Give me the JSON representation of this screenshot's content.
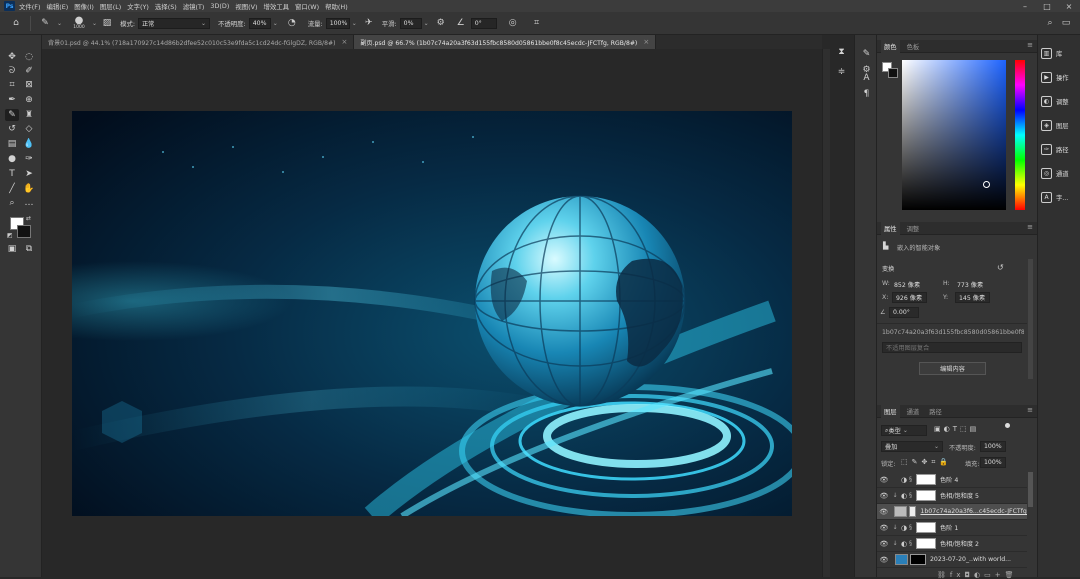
{
  "menubar": {
    "logo": "Ps",
    "items": [
      "文件(F)",
      "编辑(E)",
      "图像(I)",
      "图层(L)",
      "文字(Y)",
      "选择(S)",
      "滤镜(T)",
      "3D(D)",
      "视图(V)",
      "增效工具",
      "窗口(W)",
      "帮助(H)"
    ]
  },
  "options": {
    "brush_size": "1000",
    "mode_label": "模式:",
    "mode_value": "正常",
    "opacity_label": "不透明度:",
    "opacity_value": "40%",
    "flow_label": "流量:",
    "flow_value": "100%",
    "smooth_label": "平滑:",
    "smooth_value": "0%",
    "angle_value": "0°"
  },
  "tabs": [
    {
      "label": "背景01.psd @ 44.1% (718a170927c14d86b2dfee52c010c53e9fda5c1cd24dc-fGlgDZ, RGB/8#)",
      "close": "×"
    },
    {
      "label": "副页.psd @ 66.7% (1b07c74a20a3f63d155fbc8580d05861bbe0f8c45ecdc-JFCTfg, RGB/8#)",
      "close": "×"
    }
  ],
  "color_panel": {
    "tabs": [
      "颜色",
      "色板"
    ],
    "accent_top": "#1d63ff"
  },
  "properties": {
    "tabs": [
      "属性",
      "调整"
    ],
    "object_type": "嵌入的智能对象",
    "section": "变换",
    "w_label": "W:",
    "w_value": "852 像素",
    "h_label": "H:",
    "h_value": "773 像素",
    "x_label": "X:",
    "x_value": "926 像素",
    "y_label": "Y:",
    "y_value": "145 像素",
    "angle_value": "0.00°",
    "filename": "1b07c74a20a3f63d155fbc8580d05861bbe0f8c...",
    "comp_placeholder": "不适用图层复合",
    "edit_button": "编辑内容"
  },
  "layers": {
    "tabs": [
      "图层",
      "通道",
      "路径"
    ],
    "filter_label": "类型",
    "blend_mode": "叠加",
    "opacity_label": "不透明度:",
    "opacity_value": "100%",
    "lock_label": "锁定:",
    "fill_label": "填充:",
    "fill_value": "100%",
    "items": [
      {
        "name": "色阶 4",
        "type": "levels",
        "clip": false
      },
      {
        "name": "色相/饱和度 5",
        "type": "hue",
        "clip": true
      },
      {
        "name": "1b07c74a20a3f6...c45ecdc-JFCTfg...",
        "type": "smart",
        "clip": false,
        "selected": true
      },
      {
        "name": "色阶 1",
        "type": "levels",
        "clip": true
      },
      {
        "name": "色相/饱和度 2",
        "type": "hue",
        "clip": true
      },
      {
        "name": "2023-07-20_..with world...",
        "type": "image",
        "clip": false
      }
    ]
  },
  "dock": {
    "items": [
      "库",
      "操作",
      "调整",
      "图层",
      "路径",
      "通道",
      "字..."
    ]
  }
}
